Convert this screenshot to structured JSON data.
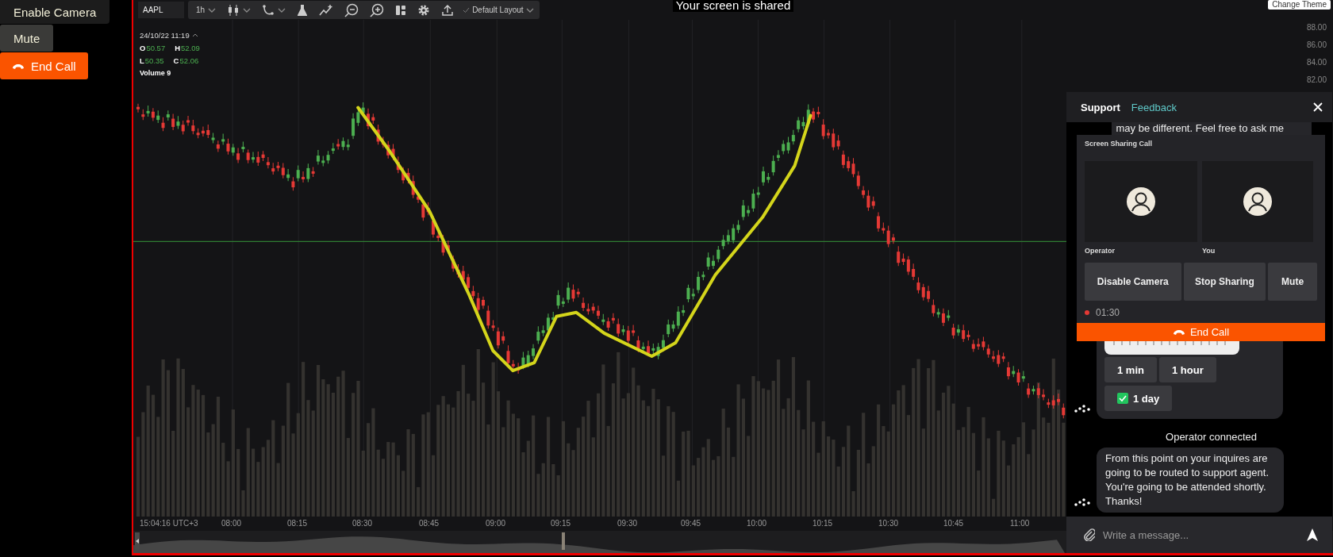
{
  "call_controls": [
    {
      "label": "Enable Camera",
      "kind": "dark"
    },
    {
      "label": "Mute",
      "kind": "grey"
    },
    {
      "label": "End Call",
      "kind": "danger"
    }
  ],
  "share_banner": "Your screen is shared",
  "theme_button": "Change Theme",
  "toolbar": {
    "symbol": "AAPL",
    "interval": "1h",
    "layout": "Default Layout"
  },
  "legend": {
    "datetime": "24/10/22 11:19",
    "rows": [
      [
        {
          "key": "O",
          "value": "50.57"
        },
        {
          "key": "H",
          "value": "52.09"
        }
      ],
      [
        {
          "key": "L",
          "value": "50.35"
        },
        {
          "key": "C",
          "value": "52.06"
        }
      ]
    ],
    "volume": "Volume 9"
  },
  "price_axis": [
    "88.00",
    "86.00",
    "84.00",
    "82.00"
  ],
  "time_axis": [
    "15:04:16 UTC+3",
    "08:00",
    "08:15",
    "08:30",
    "08:45",
    "09:00",
    "09:15",
    "09:30",
    "09:45",
    "10:00",
    "10:15",
    "10:30",
    "10:45",
    "11:00"
  ],
  "chat": {
    "tabs": [
      {
        "label": "Support",
        "selected": true
      },
      {
        "label": "Feedback",
        "selected": false
      }
    ],
    "partial_message": "may be different. Feel free to ask me",
    "call": {
      "title": "Screen Sharing Call",
      "participants": [
        {
          "name": "Operator"
        },
        {
          "name": "You"
        }
      ],
      "buttons": [
        "Disable Camera",
        "Stop Sharing",
        "Mute"
      ],
      "timer": "01:30",
      "end_button": "End Call"
    },
    "messages": [
      {
        "kind": "options",
        "options": [
          {
            "label": "1 min",
            "checked": false
          },
          {
            "label": "1 hour",
            "checked": false
          },
          {
            "label": "1 day",
            "checked": true
          }
        ]
      },
      {
        "kind": "system",
        "text": "Operator connected"
      },
      {
        "kind": "text",
        "text": "From this point on your inquires are going to be routed to support agent. You're going to be attended shortly. Thanks!"
      }
    ],
    "input": {
      "placeholder": "Write a message..."
    }
  }
}
